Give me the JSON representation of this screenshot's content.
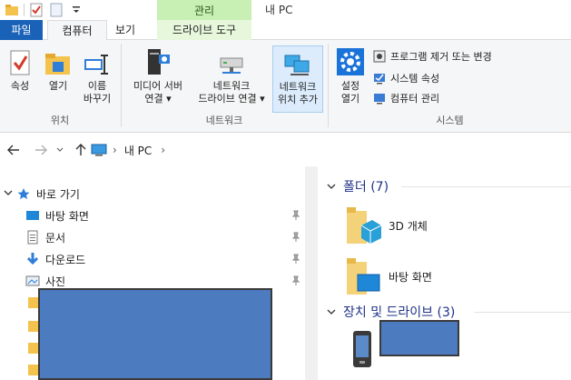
{
  "titlebar": {
    "manage_tab": "관리",
    "window_title": "내 PC"
  },
  "tabs": {
    "file": "파일",
    "computer": "컴퓨터",
    "view": "보기",
    "drive_tools": "드라이브 도구"
  },
  "ribbon": {
    "location": {
      "label": "위치",
      "properties": "속성",
      "open": "열기",
      "rename_line1": "이름",
      "rename_line2": "바꾸기"
    },
    "network": {
      "label": "네트워크",
      "media_line1": "미디어 서버",
      "media_line2": "연결 ▾",
      "map_line1": "네트워크",
      "map_line2": "드라이브 연결 ▾",
      "add_line1": "네트워크",
      "add_line2": "위치 추가"
    },
    "system": {
      "label": "시스템",
      "settings_line1": "설정",
      "settings_line2": "열기",
      "uninstall": "프로그램 제거 또는 변경",
      "sys_props": "시스템 속성",
      "manage": "컴퓨터 관리"
    }
  },
  "address": {
    "separator": "›",
    "location": "내 PC",
    "trailing": "›"
  },
  "navpane": {
    "quick_access": "바로 가기",
    "items": [
      {
        "label": "바탕 화면"
      },
      {
        "label": "문서"
      },
      {
        "label": "다운로드"
      },
      {
        "label": "사진"
      }
    ]
  },
  "content": {
    "folders_header": "폴더 (7)",
    "folders": [
      {
        "label": "3D 개체"
      },
      {
        "label": "바탕 화면"
      }
    ],
    "devices_header": "장치 및 드라이브 (3)"
  },
  "colors": {
    "accent": "#1a61b8",
    "manage": "#c8efb4",
    "header_text": "#1e3287",
    "redaction": "#4c7bbf"
  }
}
